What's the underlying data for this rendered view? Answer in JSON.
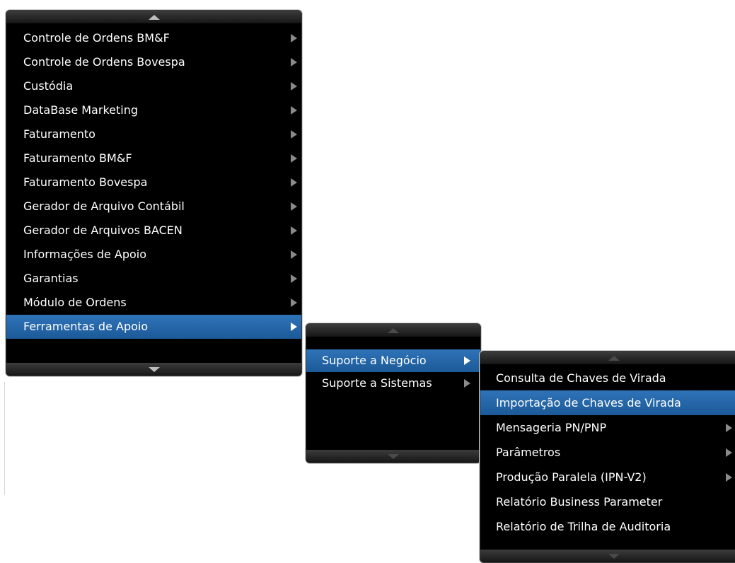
{
  "main_menu": {
    "items": [
      {
        "label": "Controle de Ordens BM&F",
        "has_submenu": true
      },
      {
        "label": "Controle de Ordens Bovespa",
        "has_submenu": true
      },
      {
        "label": "Custódia",
        "has_submenu": true
      },
      {
        "label": "DataBase Marketing",
        "has_submenu": true
      },
      {
        "label": "Faturamento",
        "has_submenu": true
      },
      {
        "label": "Faturamento BM&F",
        "has_submenu": true
      },
      {
        "label": "Faturamento Bovespa",
        "has_submenu": true
      },
      {
        "label": "Gerador de Arquivo Contábil",
        "has_submenu": true
      },
      {
        "label": "Gerador de Arquivos BACEN",
        "has_submenu": true
      },
      {
        "label": "Informações de Apoio",
        "has_submenu": true
      },
      {
        "label": "Garantias",
        "has_submenu": true
      },
      {
        "label": "Módulo de Ordens",
        "has_submenu": true
      },
      {
        "label": "Ferramentas de Apoio",
        "has_submenu": true,
        "active": true
      }
    ]
  },
  "submenu_1": {
    "items": [
      {
        "label": "Suporte a Negócio",
        "has_submenu": true,
        "active": true
      },
      {
        "label": "Suporte a Sistemas",
        "has_submenu": true
      }
    ]
  },
  "submenu_2": {
    "items": [
      {
        "label": "Consulta de Chaves de Virada",
        "has_submenu": false
      },
      {
        "label": "Importação de Chaves de Virada",
        "has_submenu": false,
        "active": true
      },
      {
        "label": "Mensageria PN/PNP",
        "has_submenu": true
      },
      {
        "label": "Parâmetros",
        "has_submenu": true
      },
      {
        "label": "Produção Paralela (IPN-V2)",
        "has_submenu": true
      },
      {
        "label": "Relatório Business Parameter",
        "has_submenu": false
      },
      {
        "label": "Relatório de Trilha de Auditoria",
        "has_submenu": false
      }
    ]
  },
  "icons": {
    "scroll_up": "triangle-up-icon",
    "scroll_down": "triangle-down-icon",
    "submenu": "chevron-right-icon"
  },
  "colors": {
    "menu_background": "#000000",
    "highlight": "#2f73b8",
    "text": "#ffffff",
    "arrow": "#8a8a8a"
  }
}
